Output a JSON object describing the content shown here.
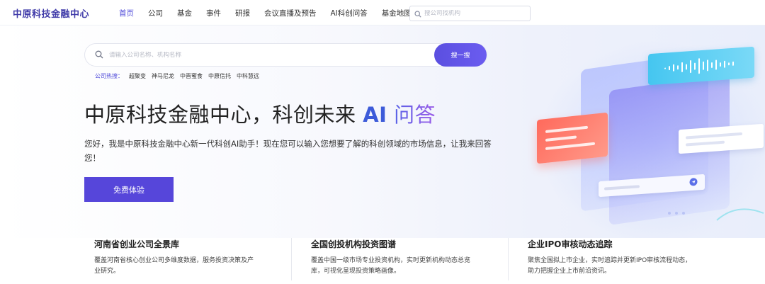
{
  "header": {
    "logo": "中原科技金融中心",
    "nav": [
      {
        "label": "首页",
        "active": true
      },
      {
        "label": "公司",
        "active": false
      },
      {
        "label": "基金",
        "active": false
      },
      {
        "label": "事件",
        "active": false
      },
      {
        "label": "研报",
        "active": false
      },
      {
        "label": "会议直播及预告",
        "active": false
      },
      {
        "label": "AI科创问答",
        "active": false
      },
      {
        "label": "基金地图",
        "active": false
      }
    ],
    "search_placeholder": "搜公司找机构"
  },
  "hero": {
    "search_placeholder": "请输入公司名称、机构名称",
    "search_button": "搜一搜",
    "hot_label": "公司热搜：",
    "hot_items": [
      "超聚变",
      "神马尼龙",
      "中晋蜜食",
      "中原信托",
      "中科慧远"
    ],
    "title_main": "中原科技金融中心，科创未来 ",
    "title_ai": "AI",
    "title_qa": " 问答",
    "description": "您好，我是中原科技金融中心新一代科创AI助手！现在您可以输入您想要了解的科创领域的市场信息，让我来回答您！",
    "cta_button": "免费体验"
  },
  "features": [
    {
      "title": "河南省创业公司全景库",
      "desc": "覆盖河南省核心创业公司多维度数据，服务投资决策及产业研究。"
    },
    {
      "title": "全国创投机构投资图谱",
      "desc": "覆盖中国一级市场专业投资机构，实时更新机构动态总览库，可视化呈现投资策略画像。"
    },
    {
      "title": "企业IPO审核动态追踪",
      "desc": "聚焦全国拟上市企业，实时追踪并更新IPO审核流程动态，助力把握企业上市前沿资讯。"
    }
  ],
  "colors": {
    "brand": "#4b46d8",
    "button": "#5646da",
    "ai_text": "#3d5bd9"
  }
}
